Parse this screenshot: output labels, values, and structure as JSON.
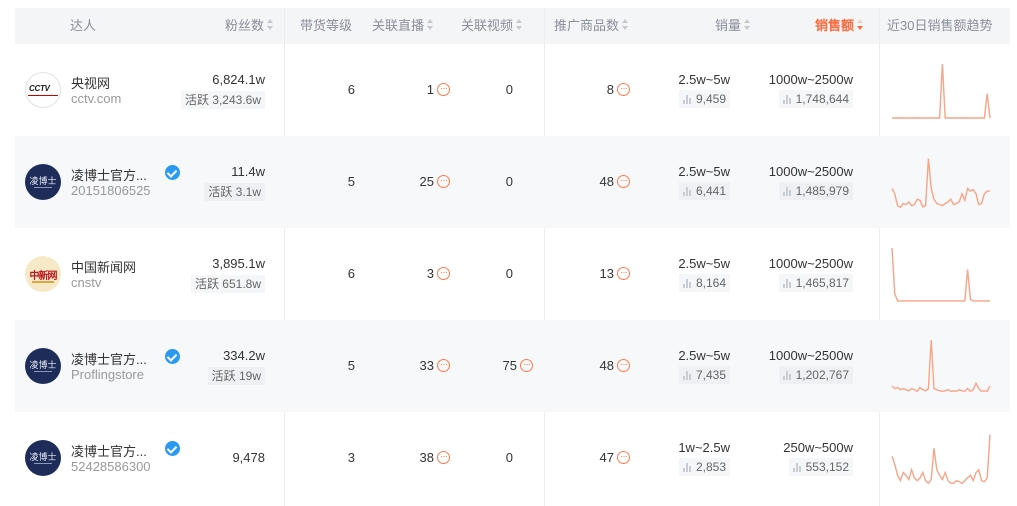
{
  "header": {
    "influencer": "达人",
    "fans": "粉丝数",
    "level": "带货等级",
    "live": "关联直播",
    "video": "关联视频",
    "products": "推广商品数",
    "sales_volume": "销量",
    "sales_amount": "销售额",
    "trend": "近30日销售额趋势"
  },
  "accent_color": "#ff6a3d",
  "rows": [
    {
      "avatar": "cctv-logo",
      "avatar_text": "CCTV",
      "name": "央视网",
      "sub": "cctv.com",
      "verified": false,
      "fans": "6,824.1w",
      "active": "活跃 3,243.6w",
      "level": "6",
      "live": "1",
      "video": "0",
      "products": "8",
      "volume_range": "2.5w~5w",
      "volume_est": "9,459",
      "amount_range": "1000w~2500w",
      "amount_est": "1,748,644",
      "trend": [
        0,
        0,
        0,
        0,
        0,
        0,
        0,
        0,
        0,
        0,
        0,
        0,
        0,
        0,
        0,
        0,
        0,
        0,
        1.0,
        0,
        0,
        0,
        0,
        0,
        0,
        0,
        0,
        0,
        0,
        0,
        0,
        0,
        0,
        0,
        0.45,
        0
      ]
    },
    {
      "avatar": "lingboshi-logo",
      "avatar_text": "凌博士",
      "name": "凌博士官方...",
      "sub": "20151806525",
      "verified": true,
      "fans": "11.4w",
      "active": "活跃 3.1w",
      "level": "5",
      "live": "25",
      "video": "0",
      "products": "48",
      "volume_range": "2.5w~5w",
      "volume_est": "6,441",
      "amount_range": "1000w~2500w",
      "amount_est": "1,485,979",
      "trend": [
        0.4,
        0.3,
        0.08,
        0.05,
        0.12,
        0.1,
        0.15,
        0.08,
        0.1,
        0.2,
        0.18,
        0.06,
        0.08,
        0.95,
        0.4,
        0.2,
        0.12,
        0.1,
        0.08,
        0.12,
        0.15,
        0.2,
        0.1,
        0.12,
        0.15,
        0.3,
        0.18,
        0.4,
        0.35,
        0.38,
        0.3,
        0.1,
        0.12,
        0.3,
        0.35,
        0.35
      ]
    },
    {
      "avatar": "cns-logo",
      "avatar_text": "中新网",
      "name": "中国新闻网",
      "sub": "cnstv",
      "verified": false,
      "fans": "3,895.1w",
      "active": "活跃 651.8w",
      "level": "6",
      "live": "3",
      "video": "0",
      "products": "13",
      "volume_range": "2.5w~5w",
      "volume_est": "8,164",
      "amount_range": "1000w~2500w",
      "amount_est": "1,465,817",
      "trend": [
        1.0,
        0.15,
        0.02,
        0.02,
        0.02,
        0.02,
        0.02,
        0.02,
        0.02,
        0.02,
        0.02,
        0.02,
        0.02,
        0.02,
        0.02,
        0.02,
        0.02,
        0.02,
        0.02,
        0.02,
        0.02,
        0.02,
        0.02,
        0.02,
        0.02,
        0.02,
        0.02,
        0.6,
        0.05,
        0.02,
        0.02,
        0.02,
        0.02,
        0.02,
        0.02,
        0.02
      ]
    },
    {
      "avatar": "lingboshi-logo",
      "avatar_text": "凌博士",
      "name": "凌博士官方...",
      "sub": "Proflingstore",
      "verified": true,
      "fans": "334.2w",
      "active": "活跃 19w",
      "level": "5",
      "live": "33",
      "video": "75",
      "products": "48",
      "volume_range": "2.5w~5w",
      "volume_est": "7,435",
      "amount_range": "1000w~2500w",
      "amount_est": "1,202,767",
      "trend": [
        0.15,
        0.1,
        0.12,
        0.08,
        0.1,
        0.08,
        0.06,
        0.1,
        0.08,
        0.05,
        0.12,
        0.08,
        0.06,
        0.1,
        1.0,
        0.1,
        0.08,
        0.06,
        0.05,
        0.06,
        0.08,
        0.05,
        0.06,
        0.05,
        0.08,
        0.06,
        0.05,
        0.1,
        0.05,
        0.08,
        0.2,
        0.1,
        0.05,
        0.06,
        0.05,
        0.15
      ]
    },
    {
      "avatar": "lingboshi-logo",
      "avatar_text": "凌博士",
      "name": "凌博士官方...",
      "sub": "52428586300",
      "verified": true,
      "fans": "9,478",
      "active": "",
      "level": "3",
      "live": "38",
      "video": "0",
      "products": "47",
      "volume_range": "1w~2.5w",
      "volume_est": "2,853",
      "amount_range": "250w~500w",
      "amount_est": "553,152",
      "trend": [
        0.55,
        0.4,
        0.2,
        0.1,
        0.25,
        0.2,
        0.12,
        0.3,
        0.15,
        0.1,
        0.15,
        0.25,
        0.1,
        0.05,
        0.12,
        0.7,
        0.3,
        0.2,
        0.12,
        0.25,
        0.1,
        0.05,
        0.05,
        0.1,
        0.08,
        0.05,
        0.1,
        0.15,
        0.2,
        0.1,
        0.25,
        0.3,
        0.1,
        0.08,
        0.15,
        0.95
      ]
    }
  ]
}
